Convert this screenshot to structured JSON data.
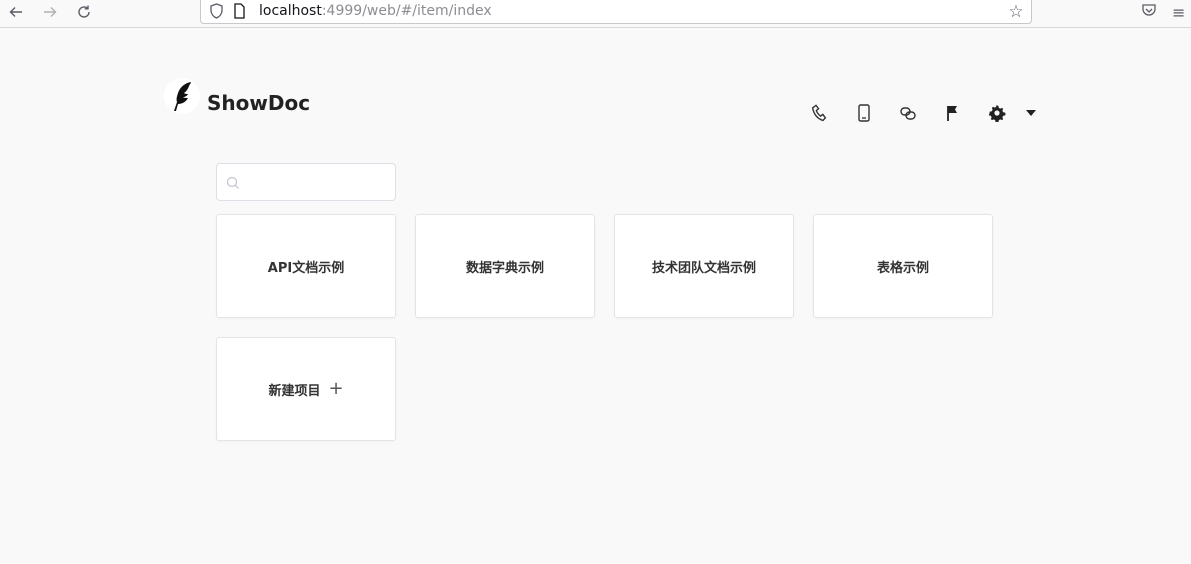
{
  "browser": {
    "url_host": "localhost",
    "url_path": ":4999/web/#/item/index"
  },
  "app": {
    "brand": "ShowDoc"
  },
  "header_icons": [
    "phone-icon",
    "mobile-icon",
    "link-icon",
    "flag-icon",
    "gear-icon",
    "caret-down-icon"
  ],
  "search": {
    "value": "",
    "placeholder": ""
  },
  "projects": [
    {
      "name": "API文档示例"
    },
    {
      "name": "数据字典示例"
    },
    {
      "name": "技术团队文档示例"
    },
    {
      "name": "表格示例"
    }
  ],
  "new_project": {
    "label": "新建项目",
    "plus": "+"
  },
  "colors": {
    "background": "#f9f9f9",
    "card": "#ffffff",
    "border": "#e4e4e4",
    "text": "#333333"
  }
}
